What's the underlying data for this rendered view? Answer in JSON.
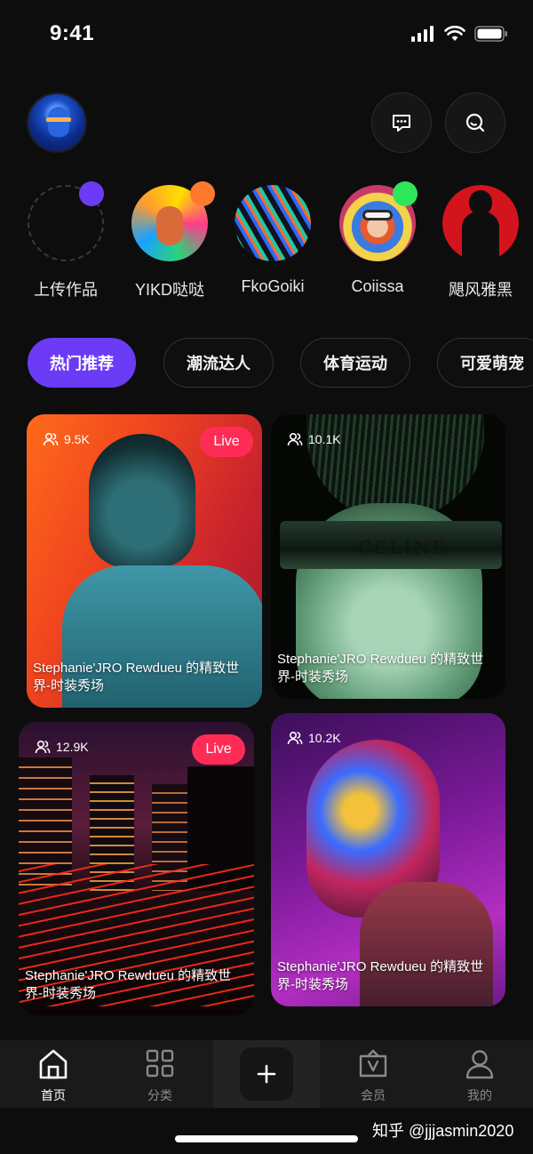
{
  "status_bar": {
    "time": "9:41"
  },
  "stories": [
    {
      "label": "上传作品",
      "dot_color": "#6c3bf5"
    },
    {
      "label": "YIKD哒哒",
      "dot_color": "#ff7a2f"
    },
    {
      "label": "FkoGoiki"
    },
    {
      "label": "Coiissa",
      "dot_color": "#2ee65a"
    },
    {
      "label": "飓风雅黑"
    }
  ],
  "categories": [
    {
      "label": "热门推荐",
      "active": true
    },
    {
      "label": "潮流达人"
    },
    {
      "label": "体育运动"
    },
    {
      "label": "可爱萌宠"
    }
  ],
  "feed": [
    {
      "viewers": "9.5K",
      "live": "Live",
      "caption": "Stephanie'JRO Rewdueu  的精致世界-时装秀场"
    },
    {
      "viewers": "10.1K",
      "caption": "Stephanie'JRO Rewdueu  的精致世界-时装秀场"
    },
    {
      "viewers": "12.9K",
      "live": "Live",
      "caption": "Stephanie'JRO Rewdueu  的精致世界-时装秀场"
    },
    {
      "viewers": "10.2K",
      "caption": "Stephanie'JRO Rewdueu  的精致世界-时装秀场"
    }
  ],
  "card2_brand": "CELINE",
  "tabbar": {
    "home": "首页",
    "category": "分类",
    "member": "会员",
    "mine": "我的"
  },
  "watermark": "知乎 @jjjasmin2020",
  "colors": {
    "accent": "#6c3bf5",
    "live": "#ff2d55",
    "background": "#0d0d0d"
  }
}
